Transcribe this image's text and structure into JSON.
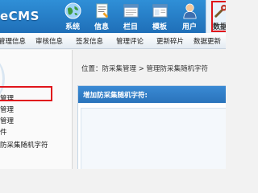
{
  "header": {
    "logo_text": "eCMS",
    "icons": [
      {
        "name": "system",
        "label": "系统"
      },
      {
        "name": "info",
        "label": "信息"
      },
      {
        "name": "column",
        "label": "栏目"
      },
      {
        "name": "template",
        "label": "模板"
      },
      {
        "name": "user",
        "label": "用户"
      },
      {
        "name": "backup",
        "label": "数据"
      }
    ],
    "active_icon": "backup"
  },
  "nav": {
    "items": [
      "管理信息",
      "审核信息",
      "签发信息",
      "管理评论",
      "更新碎片",
      "数据更新"
    ]
  },
  "sidebar": {
    "items": [
      "管理",
      "管理",
      "管理",
      "件",
      "防采集随机字符"
    ],
    "selected": "防采集随机字符"
  },
  "breadcrumb": {
    "text": "位置：防采集管理 > 管理防采集随机字符"
  },
  "panel": {
    "title": "增加防采集随机字符:"
  },
  "colors": {
    "header_blue": "#2a7fc9",
    "highlight_red": "#e0141b",
    "panel_blue": "#3080cc"
  }
}
